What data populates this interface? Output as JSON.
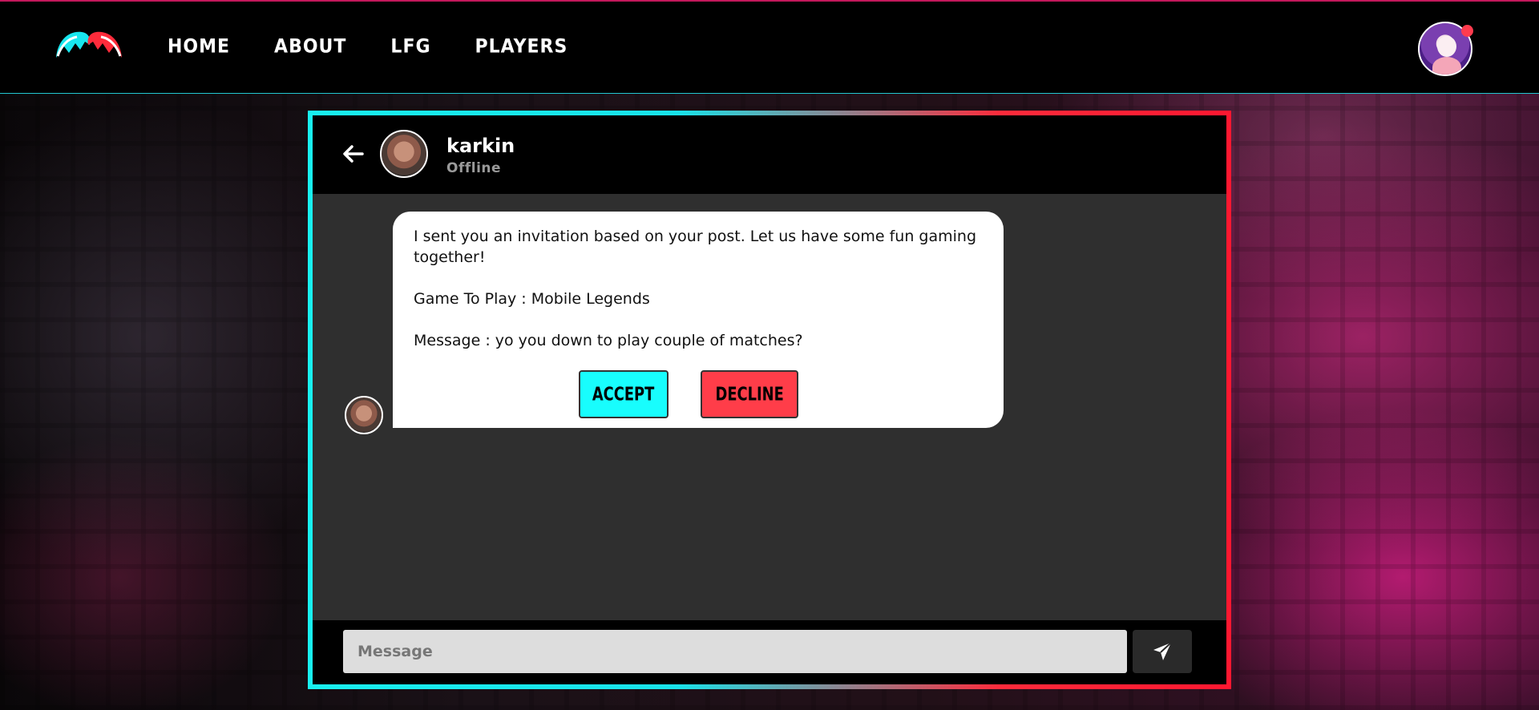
{
  "nav": {
    "links": [
      "HOME",
      "ABOUT",
      "LFG",
      "PLAYERS"
    ]
  },
  "chat": {
    "contact_name": "karkin",
    "contact_status": "Offline",
    "message": {
      "line1": "I sent you an invitation based on your post. Let us have some fun gaming together!",
      "game": "Game To Play : Mobile Legends",
      "note": "Message : yo you down to play couple of matches?",
      "accept_label": "ACCEPT",
      "decline_label": "DECLINE"
    },
    "input_placeholder": "Message"
  },
  "colors": {
    "accent_cyan": "#18fdfd",
    "accent_red": "#ff3d49"
  }
}
